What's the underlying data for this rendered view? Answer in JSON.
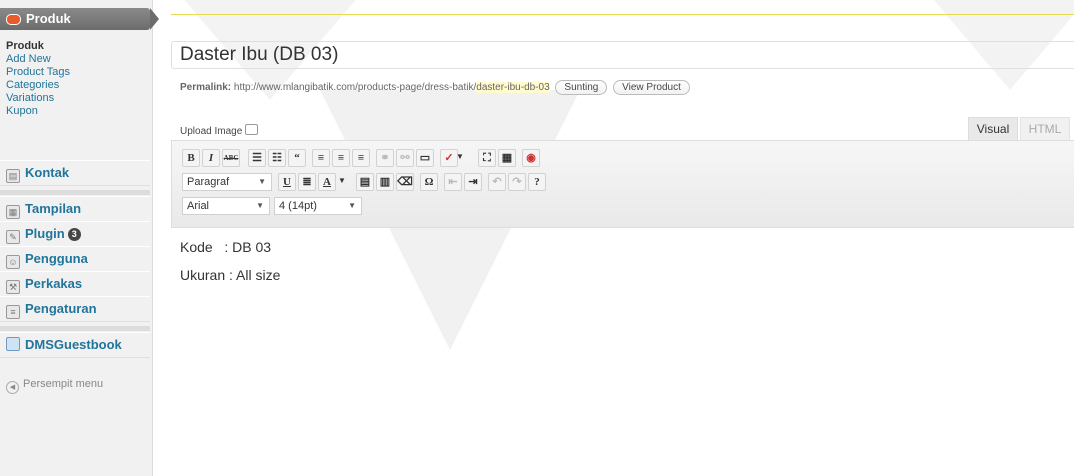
{
  "sidebar": {
    "active_menu": "Produk",
    "submenu": [
      "Produk",
      "Add New",
      "Product Tags",
      "Categories",
      "Variations",
      "Kupon"
    ],
    "items": [
      {
        "label": "Kontak",
        "icon": "contact-form-icon"
      },
      {
        "label": "Tampilan",
        "icon": "appearance-icon"
      },
      {
        "label": "Plugin",
        "icon": "plugin-icon",
        "badge": "3"
      },
      {
        "label": "Pengguna",
        "icon": "users-icon"
      },
      {
        "label": "Perkakas",
        "icon": "tools-icon"
      },
      {
        "label": "Pengaturan",
        "icon": "settings-icon"
      },
      {
        "label": "DMSGuestbook",
        "icon": "guestbook-icon"
      }
    ],
    "collapse_label": "Persempit menu"
  },
  "editor": {
    "title": "Daster Ibu (DB 03)",
    "permalink_label": "Permalink:",
    "permalink_base": "http://www.mlangibatik.com/products-page/dress-batik/",
    "permalink_slug": "daster-ibu-db-03",
    "edit_button": "Sunting",
    "view_button": "View Product",
    "upload_label": "Upload Image",
    "tab_visual": "Visual",
    "tab_html": "HTML",
    "format_select": "Paragraf",
    "font_select": "Arial",
    "size_select": "4 (14pt)",
    "content": [
      "Kode   : DB 03",
      "Ukuran : All size"
    ]
  }
}
